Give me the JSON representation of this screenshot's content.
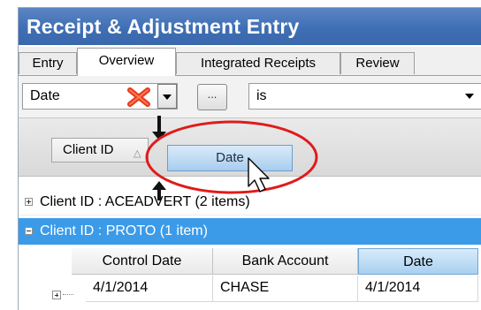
{
  "window": {
    "title": "Receipt & Adjustment Entry"
  },
  "tabs": [
    {
      "label": "Entry"
    },
    {
      "label": "Overview"
    },
    {
      "label": "Integrated Receipts"
    },
    {
      "label": "Review"
    }
  ],
  "filter": {
    "field_value": "Date",
    "ellipsis_label": "...",
    "operator_value": "is"
  },
  "group_panel": {
    "grouped_column": "Client ID",
    "dragged_column": "Date"
  },
  "groups": [
    {
      "label": "Client ID : ACEADVERT (2 items)"
    },
    {
      "label": "Client ID : PROTO (1 item)"
    }
  ],
  "table": {
    "columns": [
      "Control Date",
      "Bank Account",
      "Date"
    ],
    "rows": [
      [
        "4/1/2014",
        "CHASE",
        "4/1/2014"
      ]
    ]
  },
  "colors": {
    "title_bar": "#3f6eb4",
    "selected_row": "#3b9be8",
    "highlight_circle": "#e01b1b",
    "delete_icon": "#e53b1e"
  },
  "icons": {
    "delete": "red-x-icon",
    "dropdown": "chevron-down-icon",
    "cursor": "mouse-pointer-icon",
    "drop_indicator": "arrow-down-icon"
  }
}
